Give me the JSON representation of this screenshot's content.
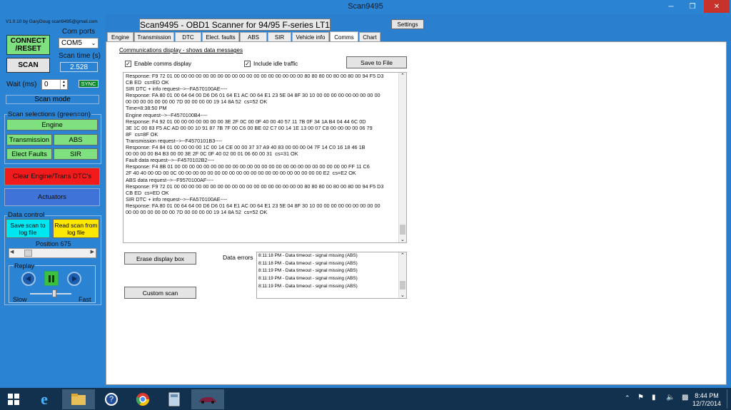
{
  "window": {
    "title": "Scan9495"
  },
  "app": {
    "version": "V1.0.10  by GaryDoug  scan9495@gmail.com",
    "title": "Scan9495 - OBD1 Scanner for 94/95 F-series LT1",
    "settings_label": "Settings"
  },
  "left": {
    "connect_label": "CONNECT /RESET",
    "com_ports_label": "Com ports",
    "com_port_value": "COM5",
    "scan_label": "SCAN",
    "scan_time_label": "Scan time (s)",
    "scan_time_value": "2.528",
    "wait_label": "Wait (ms)",
    "wait_value": "0",
    "sync_label": "SYNC",
    "scan_mode_label": "Scan mode",
    "scan_selections_label": "Scan selections (green=on)",
    "engine_label": "Engine",
    "transmission_label": "Transmission",
    "abs_label": "ABS",
    "elect_faults_label": "Elect Faults",
    "sir_label": "SIR",
    "clear_label": "Clear Engine/Trans DTC's",
    "actuators_label": "Actuators",
    "data_control_label": "Data control",
    "save_scan_label": "Save scan to log file",
    "read_scan_label": "Read scan from log file",
    "position_label": "Position  675",
    "position_fraction": 0.12,
    "replay_label": "Replay",
    "slow_label": "Slow",
    "fast_label": "Fast",
    "speed_fraction": 0.6
  },
  "tabs": [
    "Engine",
    "Transmission",
    "DTC",
    "Elect. faults",
    "ABS",
    "SIR",
    "Vehicle info",
    "Comms",
    "Chart"
  ],
  "active_tab": "Comms",
  "comms": {
    "heading": "Communications display - shows data messages",
    "enable_label": "Enable comms display",
    "idle_label": "Include idle traffic",
    "save_file_label": "Save to File",
    "lines": [
      "Response: F9 72 01 00 00 00 00 00 00 00 00 00 00 00 00 00 00 00 00 00 00 80 80 80 00 80 00 80 00 94 F5 D3",
      "CB ED  cs=ED OK",
      "SIR DTC + info request-->--FA570100AE----",
      "Response: FA 80 01 00 64 64 00 D6 D6 01 64 E1 AC 00 64 E1 23 5E 04 8F 30 10 00 00 00 00 00 00 00 00 00",
      "00 00 00 00 00 00 00 7D 00 00 00 00 19 14 8A 52  cs=52 OK",
      "",
      "Time=8:38:50 PM",
      "Engine request-->--F4570100B4----",
      "Response: F4 92 01 00 00 00 00 00 00 00 3E 2F 0C 00 0F 40 00 40 57 11 7B 0F 34 1A B4 04 44 6C 0D",
      "3E 1C 00 83 F5 AC AD 00 00 10 91 87 7B 7F 00 C6 00 BE 02 C7 00 14 1E 13 00 07 C8 00 00 00 00 06 79",
      "8F  cs=8F OK",
      "Transmission request-->--F4570101B3----",
      "Response: F4 84 01 00 00 00 00 1C 00 14 CE 00 00 37 37 A9 40 83 00 00 00 04 7F 14 C0 16 18 46 1B",
      "00 00 00 00 B4 B3 00 00 3E 2F 0C 0F 40 02 00 01 06 60 00 31  cs=31 OK",
      "Fault data request-->--F4570102B2----",
      "Response: F4 8B 01 00 00 00 00 00 00 00 00 00 00 00 00 00 00 00 00 00 00 00 00 00 00 00 00 FF 11 C6",
      "2F 40 40 00 0D 00 0C 00 00 00 00 00 00 00 00 00 00 00 00 00 00 00 00 00 00 00 00 E2  cs=E2 OK",
      "ABS data request-->--F9570100AF----",
      "Response: F9 72 01 00 00 00 00 00 00 00 00 00 00 00 00 00 00 00 00 00 00 80 80 80 00 80 00 80 00 94 F5 D3",
      "CB ED  cs=ED OK",
      "SIR DTC + info request-->--FA570100AE----",
      "Response: FA 80 01 00 64 64 00 D6 D6 01 64 E1 AC 00 64 E1 23 5E 04 8F 30 10 00 00 00 00 00 00 00 00 00",
      "00 00 00 00 00 00 00 7D 00 00 00 00 19 14 8A 52  cs=52 OK"
    ],
    "erase_label": "Erase display box",
    "custom_scan_label": "Custom scan",
    "data_errors_label": "Data errors",
    "errors": [
      "8:11:18 PM - Data timeout - signal missing (ABS)",
      "8:11:18 PM - Data timeout - signal missing (ABS)",
      "8:11:19 PM - Data timeout - signal missing (ABS)",
      "8:11:19 PM - Data timeout - signal missing (ABS)",
      "8:11:19 PM - Data timeout - signal missing (ABS)"
    ]
  },
  "taskbar": {
    "time": "8:44 PM",
    "date": "12/7/2014"
  },
  "colors": {
    "green_button": "#7fe07f",
    "red_button": "#f21a1a",
    "blue_button": "#3f73d8",
    "cyan_button": "#00e6f0",
    "yellow_button": "#ffe800",
    "panel_blue": "#2b83d3"
  }
}
